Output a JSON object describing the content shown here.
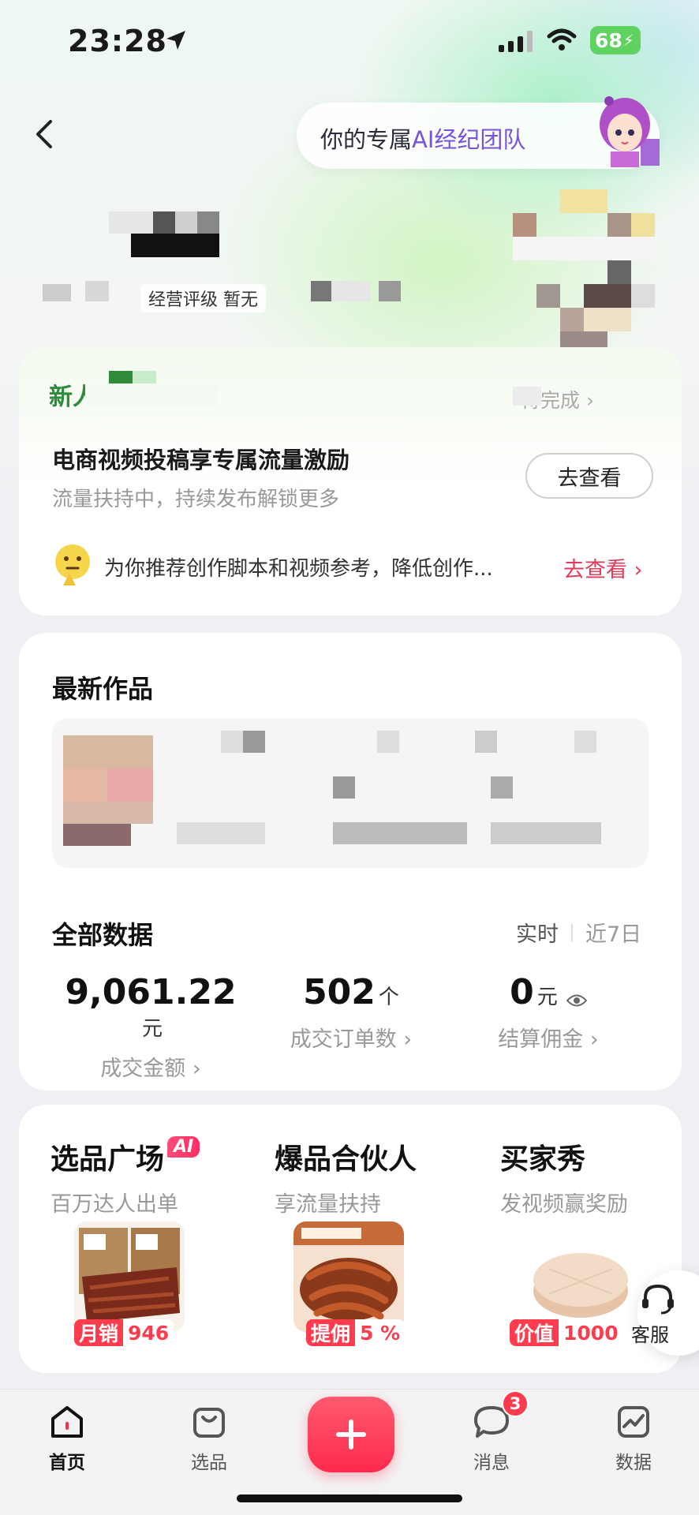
{
  "status_bar": {
    "time": "23:28",
    "battery": "68"
  },
  "header": {
    "ai_prefix": "你的专属",
    "ai_highlight": "AI经纪团队",
    "rating_label": "经营评级 暂无"
  },
  "task_card": {
    "title": "新人任务",
    "right_label": "待完成",
    "headline": "电商视频投稿享专属流量激励",
    "subline": "流量扶持中，持续发布解锁更多",
    "button": "去查看",
    "tip": "为你推荐创作脚本和视频参考，降低创作...",
    "tip_link": "去查看 ›"
  },
  "latest": {
    "title": "最新作品"
  },
  "stats": {
    "title": "全部数据",
    "tab_realtime": "实时",
    "tab_7d": "近7日",
    "items": [
      {
        "value": "9,061.22",
        "unit": "元",
        "label": "成交金额 ›"
      },
      {
        "value": "502",
        "unit": "个",
        "label": "成交订单数 ›"
      },
      {
        "value": "0",
        "unit": "元",
        "label": "结算佣金 ›"
      }
    ]
  },
  "features": [
    {
      "title": "选品广场",
      "badge": "AI",
      "sub": "百万达人出单",
      "tag_key": "月销",
      "tag_val": "946"
    },
    {
      "title": "爆品合伙人",
      "sub": "享流量扶持",
      "tag_key": "提佣",
      "tag_val": "5 %"
    },
    {
      "title": "买家秀",
      "sub": "发视频赢奖励",
      "tag_key": "价值",
      "tag_val": "1000"
    }
  ],
  "customer_service": "客服",
  "nav": {
    "home": "首页",
    "select": "选品",
    "message": "消息",
    "message_badge": "3",
    "data": "数据"
  },
  "colors": {
    "accent": "#ff2e4e",
    "green": "#2d8b3a",
    "purple": "#7a52e0"
  }
}
